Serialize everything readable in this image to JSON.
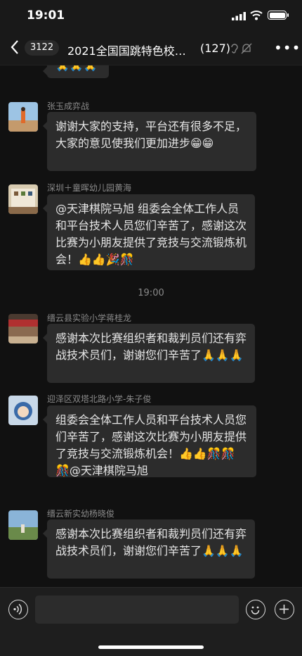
{
  "status": {
    "time": "19:01"
  },
  "header": {
    "back_icon": "chevron-left-icon",
    "unread_badge": "3122",
    "title": "2021全国国跳特色校…",
    "member_count": "(127)"
  },
  "chat": {
    "timestamp": "19:00",
    "top_partial_emoji": "🙏🙏🙏",
    "messages": [
      {
        "sender": "张玉成弈战",
        "text": "谢谢大家的支持，平台还有很多不足，大家的意见使我们更加进步😁😁"
      },
      {
        "sender": "深圳＋童晖幼儿园黄海",
        "text": "@天津棋院马旭 组委会全体工作人员和平台技术人员您们辛苦了，感谢这次比赛为小朋友提供了竞技与交流锻炼机会！👍👍🎉🎊"
      },
      {
        "sender": "缙云县实验小学蒋桂龙",
        "text": "感谢本次比赛组织者和裁判员们还有弈战技术员们，谢谢您们辛苦了🙏🙏🙏"
      },
      {
        "sender": "迎泽区双塔北路小学-朱子俊",
        "text": " 组委会全体工作人员和平台技术人员您们辛苦了，感谢这次比赛为小朋友提供了竞技与交流锻炼机会！👍👍🎊🎊🎊@天津棋院马旭"
      },
      {
        "sender": "缙云新实幼杨晓俊",
        "text": "感谢本次比赛组织者和裁判员们还有弈战技术员们，谢谢您们辛苦了🙏🙏🙏"
      }
    ]
  },
  "input": {
    "value": ""
  }
}
